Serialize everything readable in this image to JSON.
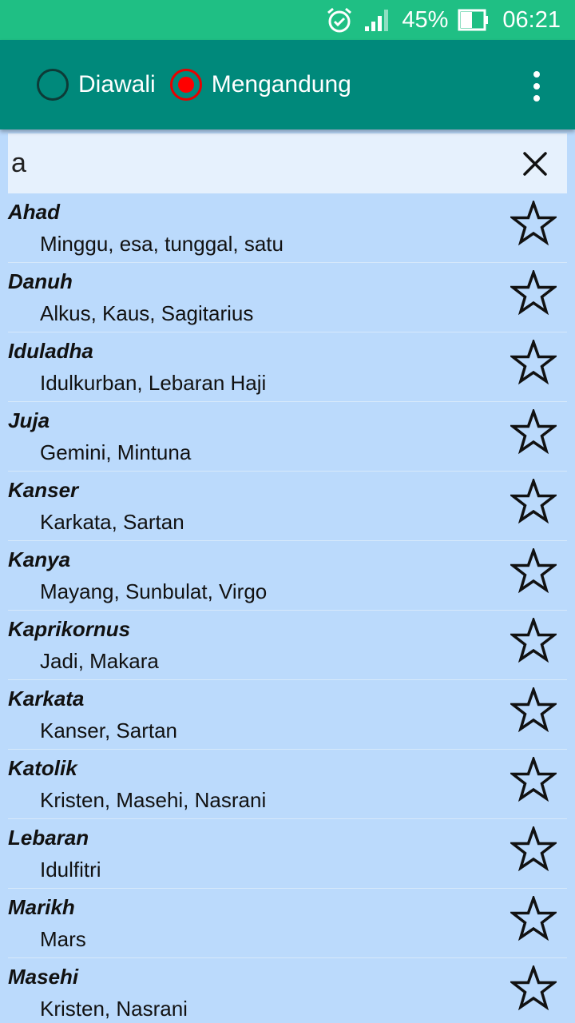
{
  "status_bar": {
    "battery_percent": "45%",
    "time": "06:21",
    "icons": [
      "alarm-icon",
      "signal-icon",
      "battery-icon"
    ]
  },
  "app_bar": {
    "options": [
      {
        "label": "Diawali",
        "selected": false
      },
      {
        "label": "Mengandung",
        "selected": true
      }
    ],
    "menu_icon": "overflow-menu-icon"
  },
  "search": {
    "value": "a",
    "clear_icon": "close-icon"
  },
  "results": [
    {
      "word": "Ahad",
      "synonyms": "Minggu, esa, tunggal, satu"
    },
    {
      "word": "Danuh",
      "synonyms": "Alkus, Kaus, Sagitarius"
    },
    {
      "word": "Iduladha",
      "synonyms": "Idulkurban, Lebaran Haji"
    },
    {
      "word": "Juja",
      "synonyms": "Gemini, Mintuna"
    },
    {
      "word": "Kanser",
      "synonyms": "Karkata, Sartan"
    },
    {
      "word": "Kanya",
      "synonyms": "Mayang, Sunbulat, Virgo"
    },
    {
      "word": "Kaprikornus",
      "synonyms": "Jadi, Makara"
    },
    {
      "word": "Karkata",
      "synonyms": "Kanser, Sartan"
    },
    {
      "word": "Katolik",
      "synonyms": "Kristen, Masehi, Nasrani"
    },
    {
      "word": "Lebaran",
      "synonyms": "Idulfitri"
    },
    {
      "word": "Marikh",
      "synonyms": "Mars"
    },
    {
      "word": "Masehi",
      "synonyms": "Kristen, Nasrani"
    }
  ],
  "colors": {
    "status_bar": "#1fbf84",
    "app_bar": "#00897b",
    "list_background": "#bbdafc",
    "search_background": "#e6f1fd",
    "radio_selected": "#ff0000"
  }
}
